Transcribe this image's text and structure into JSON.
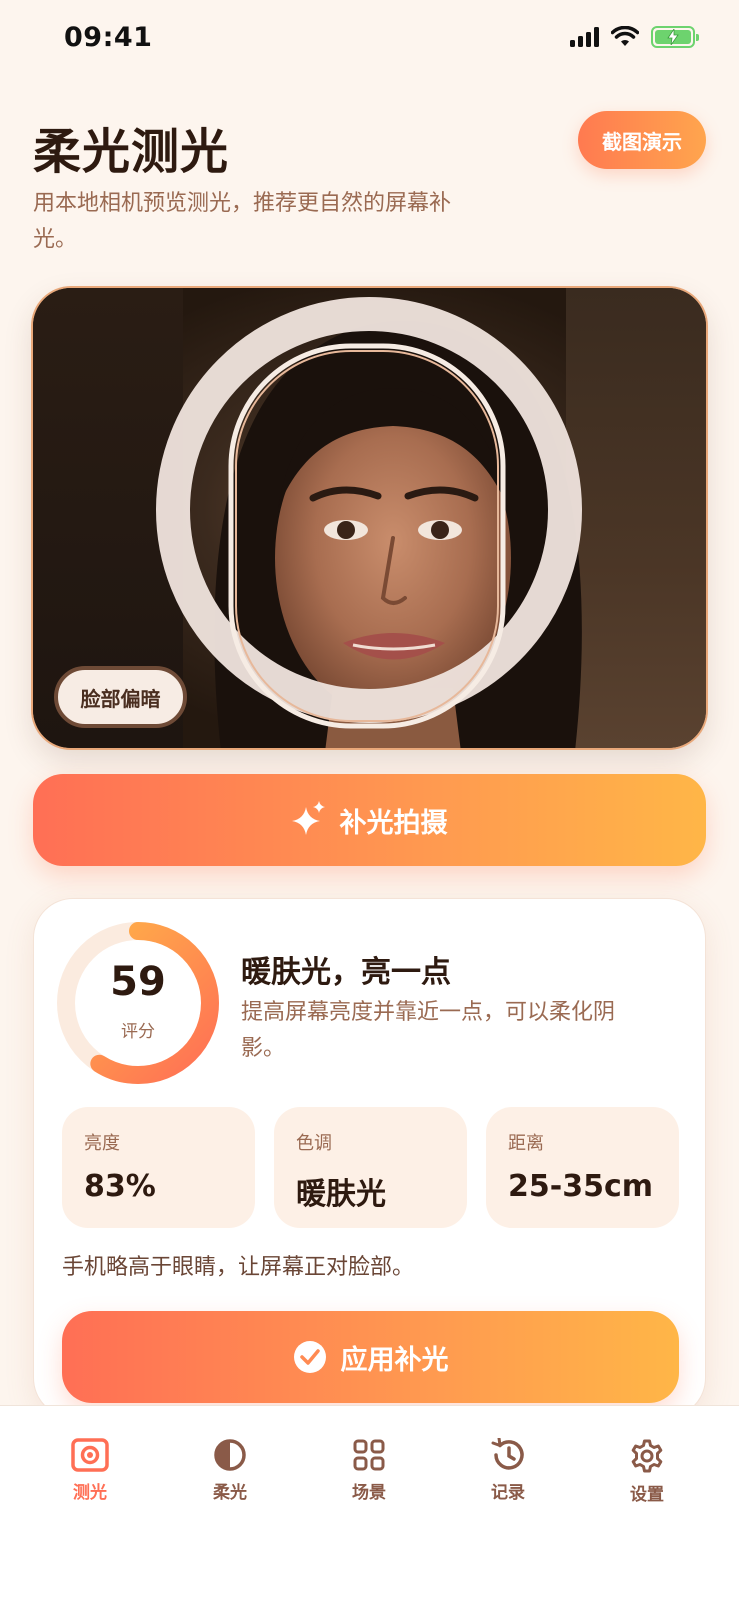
{
  "status_bar": {
    "time": "09:41"
  },
  "header": {
    "title": "柔光测光",
    "subtitle": "用本地相机预览测光，推荐更自然的屏幕补光。",
    "demo_button": "截图演示"
  },
  "camera": {
    "status_chip": "脸部偏暗"
  },
  "capture_button": {
    "label": "补光拍摄",
    "icon": "sparkle-icon"
  },
  "result": {
    "score": "59",
    "score_label": "评分",
    "score_fraction": 0.59,
    "title": "暖肤光，亮一点",
    "description": "提高屏幕亮度并靠近一点，可以柔化阴影。",
    "metrics": [
      {
        "label": "亮度",
        "value": "83%"
      },
      {
        "label": "色调",
        "value": "暖肤光"
      },
      {
        "label": "距离",
        "value": "25-35cm"
      }
    ],
    "tip": "手机略高于眼睛，让屏幕正对脸部。",
    "apply_button": {
      "label": "应用补光",
      "icon": "check-circle-icon"
    }
  },
  "tab_bar": {
    "items": [
      {
        "label": "测光",
        "icon": "meter-icon",
        "active": true
      },
      {
        "label": "柔光",
        "icon": "contrast-icon",
        "active": false
      },
      {
        "label": "场景",
        "icon": "grid-icon",
        "active": false
      },
      {
        "label": "记录",
        "icon": "history-icon",
        "active": false
      },
      {
        "label": "设置",
        "icon": "gear-icon",
        "active": false
      }
    ]
  },
  "colors": {
    "accent": "#ff6f55",
    "accent_end": "#ffb647",
    "background": "#fdf5ee"
  }
}
